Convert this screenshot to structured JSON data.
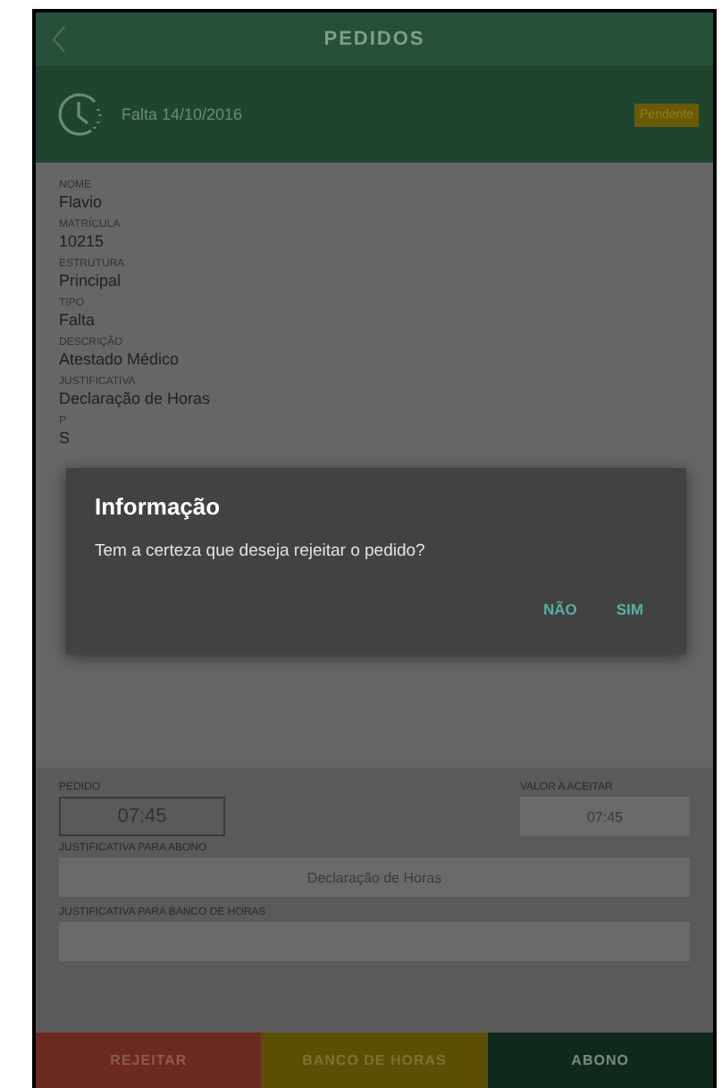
{
  "header": {
    "title": "PEDIDOS"
  },
  "summary": {
    "text": "Falta 14/10/2016",
    "status": "Pendente"
  },
  "details": [
    {
      "label": "NOME",
      "value": "Flavio"
    },
    {
      "label": "MATRÍCULA",
      "value": "10215"
    },
    {
      "label": "ESTRUTURA",
      "value": "Principal"
    },
    {
      "label": "TIPO",
      "value": "Falta"
    },
    {
      "label": "DESCRIÇÃO",
      "value": "Atestado Médico"
    },
    {
      "label": "JUSTIFICATIVA",
      "value": "Declaração de Horas"
    },
    {
      "label": "P",
      "value": "S"
    }
  ],
  "form": {
    "pedido": {
      "label": "PEDIDO",
      "value": "07:45"
    },
    "valor": {
      "label": "VALOR A ACEITAR",
      "value": "07:45"
    },
    "abono": {
      "label": "JUSTIFICATIVA PARA ABONO",
      "value": "Declaração de Horas"
    },
    "banco": {
      "label": "JUSTIFICATIVA PARA BANCO DE HORAS"
    }
  },
  "actions": [
    {
      "kind": "reject",
      "label": "REJEITAR"
    },
    {
      "kind": "bank",
      "label": "BANCO DE HORAS"
    },
    {
      "kind": "accept",
      "label": "ABONO"
    }
  ],
  "dialog": {
    "title": "Informação",
    "message": "Tem a certeza que deseja rejeitar o pedido?",
    "buttons": [
      "NÃO",
      "SIM"
    ]
  }
}
